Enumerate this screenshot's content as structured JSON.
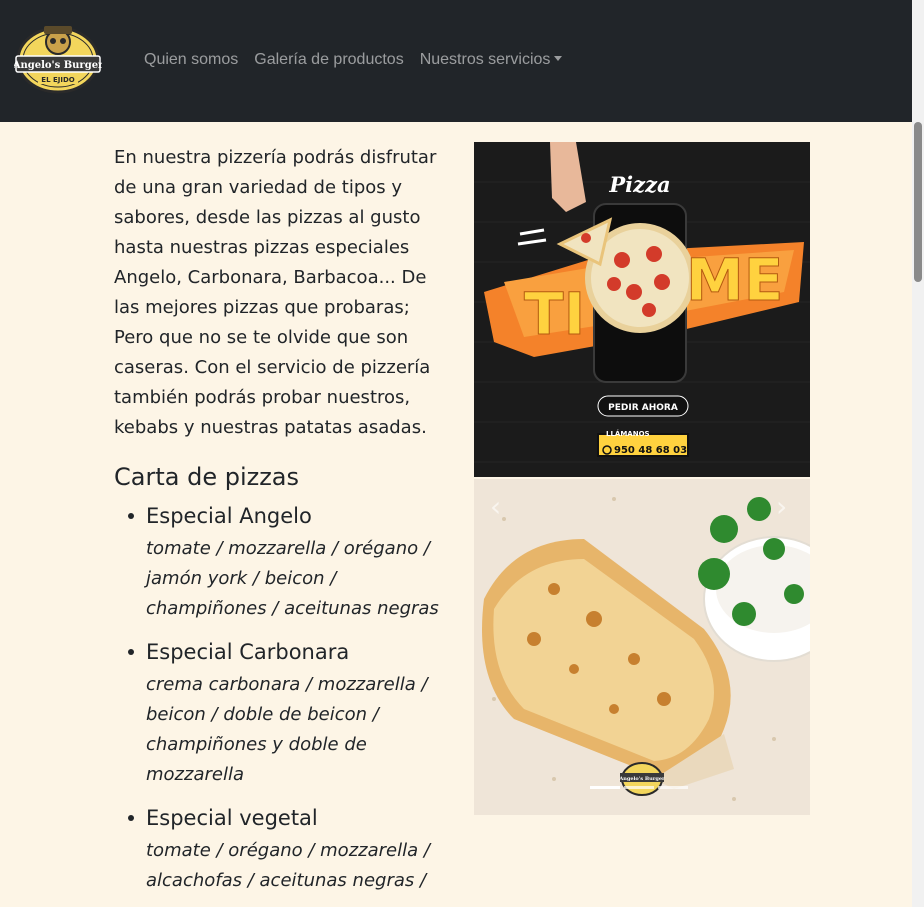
{
  "brand": {
    "name": "Angelo's Burger",
    "subtitle": "EL EJIDO"
  },
  "nav": {
    "items": [
      {
        "label": "Quien somos"
      },
      {
        "label": "Galería de productos"
      },
      {
        "label": "Nuestros servicios"
      }
    ]
  },
  "main": {
    "intro": "En nuestra pizzería podrás disfrutar de una gran variedad de tipos y sabores, desde las pizzas al gusto hasta nuestras pizzas especiales Angelo, Carbonara, Barbacoa... De las mejores pizzas que probaras; Pero que no se te olvide que son caseras. Con el servicio de pizzería también podrás probar nuestros, kebabs y nuestras patatas asadas.",
    "menu_title": "Carta de pizzas",
    "pizzas": [
      {
        "name": "Especial Angelo",
        "ingredients": "tomate / mozzarella / orégano / jamón york / beicon / champiñones / aceitunas negras"
      },
      {
        "name": "Especial Carbonara",
        "ingredients": "crema carbonara / mozzarella / beicon / doble de beicon / champiñones y doble de mozzarella"
      },
      {
        "name": "Especial vegetal",
        "ingredients": "tomate / orégano / mozzarella / alcachofas / aceitunas negras /"
      }
    ]
  },
  "carousel": {
    "promo": {
      "word_pizza": "Pizza",
      "word_time_left": "TI",
      "word_time_right": "ME",
      "order_button": "PEDIR AHORA",
      "call_label": "LLÁMANOS",
      "phone": "950 48 68 03"
    },
    "kebab_brand": "Angelo's Burger",
    "prev_icon": "‹",
    "next_icon": "›"
  },
  "colors": {
    "navbar": "#212529",
    "page_bg": "#fdf5e6",
    "accent_orange": "#f4822a",
    "accent_yellow": "#ffd23f"
  }
}
